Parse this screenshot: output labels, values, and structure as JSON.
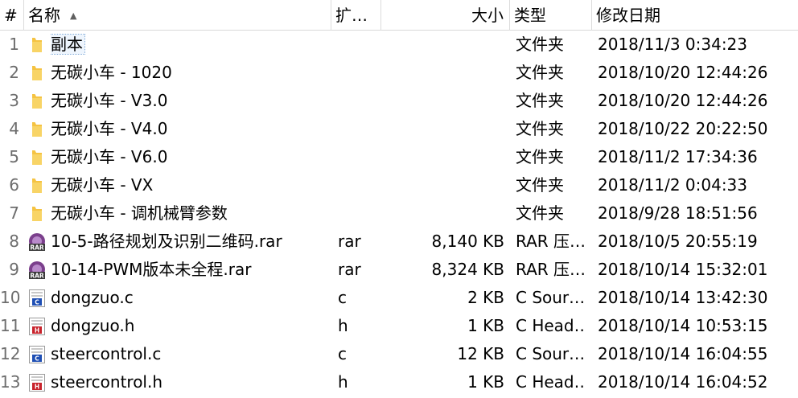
{
  "columns": {
    "index": "#",
    "name": "名称",
    "ext": "扩…",
    "size": "大小",
    "type": "类型",
    "modified": "修改日期"
  },
  "files": [
    {
      "index": "1",
      "icon": "folder-icon",
      "name": "副本",
      "ext": "",
      "size": "",
      "type": "文件夹",
      "modified": "2018/11/3 0:34:23"
    },
    {
      "index": "2",
      "icon": "folder-icon",
      "name": "无碳小车 - 1020",
      "ext": "",
      "size": "",
      "type": "文件夹",
      "modified": "2018/10/20 12:44:26"
    },
    {
      "index": "3",
      "icon": "folder-icon",
      "name": "无碳小车 - V3.0",
      "ext": "",
      "size": "",
      "type": "文件夹",
      "modified": "2018/10/20 12:44:26"
    },
    {
      "index": "4",
      "icon": "folder-icon",
      "name": "无碳小车 - V4.0",
      "ext": "",
      "size": "",
      "type": "文件夹",
      "modified": "2018/10/22 20:22:50"
    },
    {
      "index": "5",
      "icon": "folder-icon",
      "name": "无碳小车 - V6.0",
      "ext": "",
      "size": "",
      "type": "文件夹",
      "modified": "2018/11/2 17:34:36"
    },
    {
      "index": "6",
      "icon": "folder-icon",
      "name": "无碳小车 - VX",
      "ext": "",
      "size": "",
      "type": "文件夹",
      "modified": "2018/11/2 0:04:33"
    },
    {
      "index": "7",
      "icon": "folder-icon",
      "name": "无碳小车 - 调机械臂参数",
      "ext": "",
      "size": "",
      "type": "文件夹",
      "modified": "2018/9/28 18:51:56"
    },
    {
      "index": "8",
      "icon": "rar-archive-icon",
      "name": "10-5-路径规划及识别二维码.rar",
      "ext": "rar",
      "size": "8,140 KB",
      "type": "RAR 压…",
      "modified": "2018/10/5 20:55:19"
    },
    {
      "index": "9",
      "icon": "rar-archive-icon",
      "name": "10-14-PWM版本未全程.rar",
      "ext": "rar",
      "size": "8,324 KB",
      "type": "RAR 压…",
      "modified": "2018/10/14 15:32:01"
    },
    {
      "index": "10",
      "icon": "c-source-file-icon",
      "name": "dongzuo.c",
      "ext": "c",
      "size": "2 KB",
      "type": "C Sour…",
      "modified": "2018/10/14 13:42:30"
    },
    {
      "index": "11",
      "icon": "c-header-file-icon",
      "name": "dongzuo.h",
      "ext": "h",
      "size": "1 KB",
      "type": "C Head…",
      "modified": "2018/10/14 10:53:15"
    },
    {
      "index": "12",
      "icon": "c-source-file-icon",
      "name": "steercontrol.c",
      "ext": "c",
      "size": "12 KB",
      "type": "C Sour…",
      "modified": "2018/10/14 16:04:55"
    },
    {
      "index": "13",
      "icon": "c-header-file-icon",
      "name": "steercontrol.h",
      "ext": "h",
      "size": "1 KB",
      "type": "C Head…",
      "modified": "2018/10/14 16:04:52"
    }
  ],
  "colors": {
    "folder": "#f5c342",
    "rar": "#7b3f8c",
    "c_badge": "#1f4fb4",
    "h_badge": "#c8232c"
  }
}
